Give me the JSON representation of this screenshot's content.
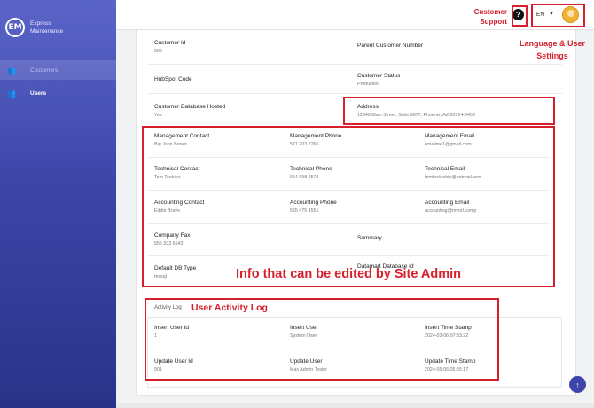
{
  "brand": {
    "logo": "EM",
    "line1": "Express",
    "line2": "Maintenance"
  },
  "nav": [
    {
      "label": "Customers",
      "icon": "people-icon"
    },
    {
      "label": "Users",
      "icon": "group-icon"
    }
  ],
  "topbar": {
    "help": "?",
    "language": "EN",
    "caret": "▼"
  },
  "fields": {
    "customer_id": {
      "label": "Customer Id",
      "value": "999"
    },
    "parent_customer_number": {
      "label": "Parent Customer Number",
      "value": ""
    },
    "hubspot_code": {
      "label": "HubSpot Code",
      "value": ""
    },
    "customer_status": {
      "label": "Customer Status",
      "value": "Production"
    },
    "customer_db_hosted": {
      "label": "Customer Database Hosted",
      "value": "Yes"
    },
    "address": {
      "label": "Address",
      "value": "12345 Main Street, Suite 9877, Phoenix, AZ 85714-3453"
    },
    "mgmt_contact": {
      "label": "Management Contact",
      "value": "Big John Brown"
    },
    "mgmt_phone": {
      "label": "Management Phone",
      "value": "571 203 7266"
    },
    "mgmt_email": {
      "label": "Management Email",
      "value": "emailme1@gmail.com"
    },
    "tech_contact": {
      "label": "Technical Contact",
      "value": "Tom Techiee"
    },
    "tech_phone": {
      "label": "Technical Phone",
      "value": "654 098 2578"
    },
    "tech_email": {
      "label": "Technical Email",
      "value": "tomthetechie@hotmail.com"
    },
    "acct_contact": {
      "label": "Accounting Contact",
      "value": "Eddie Bravo"
    },
    "acct_phone": {
      "label": "Accounting Phone",
      "value": "555 475 4551"
    },
    "acct_email": {
      "label": "Accounting Email",
      "value": "accounting@myurl.comp"
    },
    "company_fax": {
      "label": "Company Fax",
      "value": "555 333 6543"
    },
    "summary": {
      "label": "Summary",
      "value": ""
    },
    "default_db_type": {
      "label": "Default DB Type",
      "value": "mssql"
    },
    "datamart_db_id": {
      "label": "Datamart Database Id",
      "value": ""
    }
  },
  "activity": {
    "title": "Activity Log",
    "insert_user_id": {
      "label": "Insert User Id",
      "value": "1"
    },
    "insert_user": {
      "label": "Insert User",
      "value": "System User"
    },
    "insert_time": {
      "label": "Insert Time Stamp",
      "value": "2024-03-06 07:33:22"
    },
    "update_user_id": {
      "label": "Update User Id",
      "value": "901"
    },
    "update_user": {
      "label": "Update User",
      "value": "Max Admin Tester"
    },
    "update_time": {
      "label": "Update Time Stamp",
      "value": "2024-05-06 05:55:17"
    }
  },
  "annotations": {
    "support": "Customer Support",
    "support_line1": "Customer",
    "support_line2": "Support",
    "lang_line1": "Language & User",
    "lang_line2": "Settings",
    "site_admin": "Info that can be edited by Site Admin",
    "activity": "User Activity Log"
  },
  "colors": {
    "annotation": "#d6202b",
    "sidebar": "#3d46a8"
  }
}
